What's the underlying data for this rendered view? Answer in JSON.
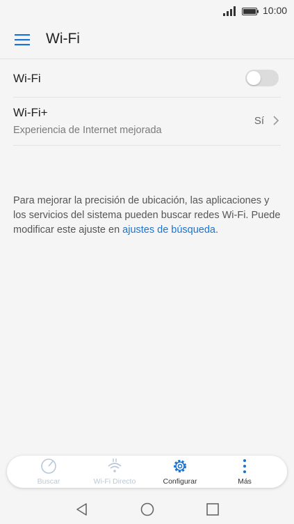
{
  "status_bar": {
    "time": "10:00",
    "signal_icon": "signal-icon",
    "battery_icon": "battery-icon"
  },
  "app_bar": {
    "menu_icon": "hamburger-menu-icon",
    "title": "Wi-Fi"
  },
  "settings": {
    "wifi": {
      "label": "Wi-Fi",
      "toggle_on": false
    },
    "wifi_plus": {
      "label": "Wi-Fi+",
      "subtitle": "Experiencia de Internet mejorada",
      "value": "Sí"
    }
  },
  "info": {
    "text": "Para mejorar la precisión de ubicación, las aplicaciones y los servicios del sistema pueden buscar redes Wi-Fi. Puede modificar este ajuste en ",
    "link": "ajustes de búsqueda",
    "suffix": "."
  },
  "bottom_tabs": [
    {
      "label": "Buscar",
      "icon": "scan-icon",
      "state": "disabled"
    },
    {
      "label": "Wi-Fi Directo",
      "icon": "wifi-direct-icon",
      "state": "disabled"
    },
    {
      "label": "Configurar",
      "icon": "gear-icon",
      "state": "active"
    },
    {
      "label": "Más",
      "icon": "more-vertical-icon",
      "state": "active"
    }
  ],
  "colors": {
    "accent": "#1b73d2",
    "disabled": "#b9c8d8",
    "background": "#f5f5f5"
  }
}
